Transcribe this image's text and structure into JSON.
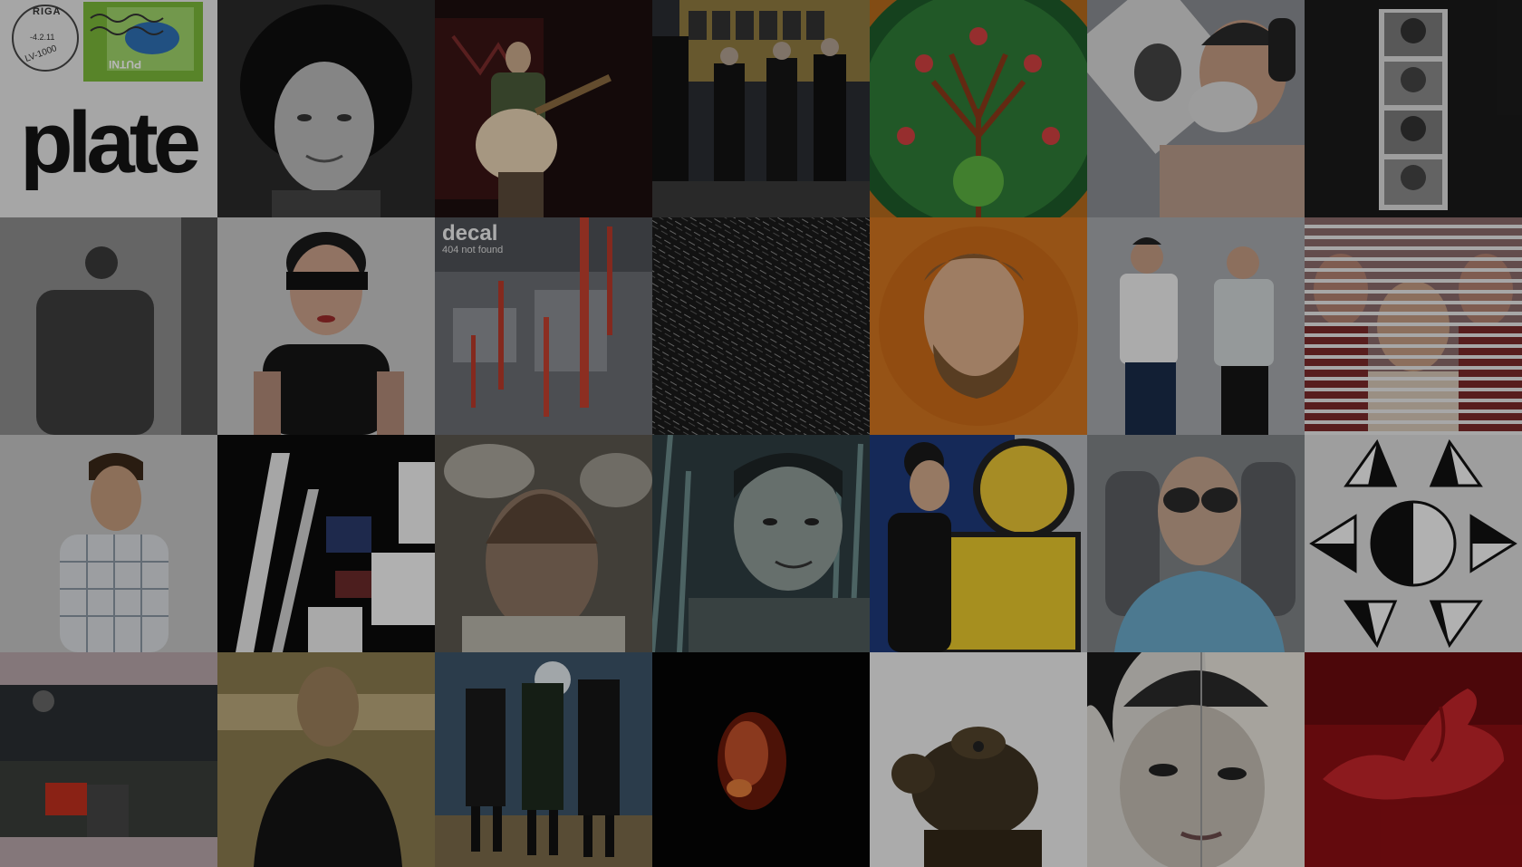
{
  "gallery": {
    "tiles": [
      {
        "name": "stamp-plate",
        "text": {
          "town": "RIGA",
          "date": "-4.2.11",
          "code": "LV-1000",
          "stamp": "PUTNI",
          "logo": "plate"
        }
      },
      {
        "name": "curly-hair-portrait"
      },
      {
        "name": "guitarist-on-stage"
      },
      {
        "name": "men-by-bus"
      },
      {
        "name": "ornamental-tree"
      },
      {
        "name": "man-with-mask"
      },
      {
        "name": "photobooth-strip"
      },
      {
        "name": "shadow-figure"
      },
      {
        "name": "blindfolded-woman"
      },
      {
        "name": "decal-cover",
        "text": {
          "title": "decal",
          "subtitle": "404 not found"
        }
      },
      {
        "name": "static-noise"
      },
      {
        "name": "bearded-head-orange"
      },
      {
        "name": "two-men-standing"
      },
      {
        "name": "striped-group-photo"
      },
      {
        "name": "man-plaid-shirt"
      },
      {
        "name": "glitch-pattern"
      },
      {
        "name": "selfie-blur"
      },
      {
        "name": "man-in-cornfield"
      },
      {
        "name": "woman-yellow-figure"
      },
      {
        "name": "man-sunglasses-car"
      },
      {
        "name": "geometric-triangles"
      },
      {
        "name": "dark-room"
      },
      {
        "name": "bald-man-sepia"
      },
      {
        "name": "three-men-hill"
      },
      {
        "name": "red-face-dark"
      },
      {
        "name": "animal-on-white"
      },
      {
        "name": "split-face-portrait"
      },
      {
        "name": "red-hand"
      }
    ]
  }
}
